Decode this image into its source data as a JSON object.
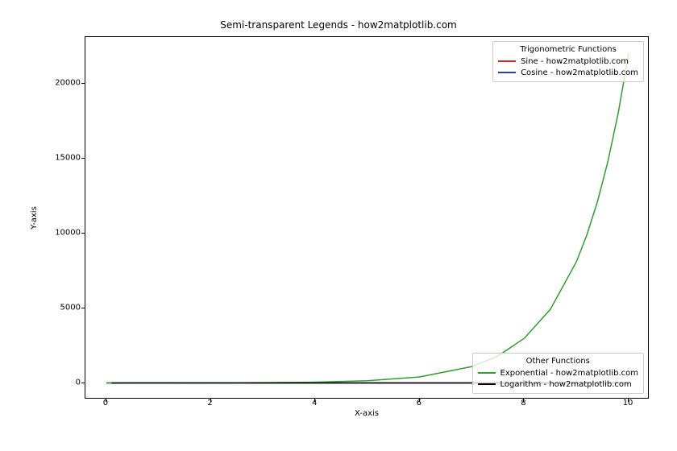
{
  "chart_data": {
    "type": "line",
    "title": "Semi-transparent Legends - how2matplotlib.com",
    "xlabel": "X-axis",
    "ylabel": "Y-axis",
    "xlim": [
      -0.4,
      10.4
    ],
    "ylim": [
      -1100,
      23100
    ],
    "xticks": [
      0,
      2,
      4,
      6,
      8,
      10
    ],
    "yticks": [
      0,
      5000,
      10000,
      15000,
      20000
    ],
    "series": [
      {
        "name": "Sine - how2matplotlib.com",
        "color": "#d62728",
        "x": [
          0,
          1,
          2,
          3,
          4,
          5,
          6,
          7,
          8,
          9,
          10
        ],
        "y": [
          0,
          0.84,
          0.91,
          0.14,
          -0.76,
          -0.96,
          -0.28,
          0.66,
          0.99,
          0.41,
          -0.54
        ]
      },
      {
        "name": "Cosine - how2matplotlib.com",
        "color": "#1f3fbf",
        "x": [
          0,
          1,
          2,
          3,
          4,
          5,
          6,
          7,
          8,
          9,
          10
        ],
        "y": [
          1,
          0.54,
          -0.42,
          -0.99,
          -0.65,
          0.28,
          0.96,
          0.75,
          -0.15,
          -0.91,
          -0.84
        ]
      },
      {
        "name": "Exponential - how2matplotlib.com",
        "color": "#2ca02c",
        "x": [
          0,
          1,
          2,
          3,
          4,
          5,
          6,
          7,
          7.5,
          8,
          8.5,
          9,
          9.2,
          9.4,
          9.6,
          9.8,
          10
        ],
        "y": [
          1,
          2.72,
          7.39,
          20.1,
          54.6,
          148.4,
          403.4,
          1096.6,
          1808,
          2981,
          4914,
          8103,
          9897,
          12088,
          14765,
          18034,
          22026
        ]
      },
      {
        "name": "Logarithm - how2matplotlib.com",
        "color": "#000000",
        "x": [
          0.1,
          0.5,
          1,
          2,
          3,
          4,
          5,
          6,
          7,
          8,
          9,
          10
        ],
        "y": [
          -2.3,
          -0.69,
          0,
          0.69,
          1.1,
          1.39,
          1.61,
          1.79,
          1.95,
          2.08,
          2.2,
          2.3
        ]
      }
    ],
    "legends": [
      {
        "title": "Trigonometric Functions",
        "position": "upper right",
        "entries": [
          {
            "label": "Sine - how2matplotlib.com",
            "color": "#d62728"
          },
          {
            "label": "Cosine - how2matplotlib.com",
            "color": "#1f3fbf"
          }
        ]
      },
      {
        "title": "Other Functions",
        "position": "lower right",
        "entries": [
          {
            "label": "Exponential - how2matplotlib.com",
            "color": "#2ca02c"
          },
          {
            "label": "Logarithm - how2matplotlib.com",
            "color": "#000000"
          }
        ]
      }
    ]
  }
}
